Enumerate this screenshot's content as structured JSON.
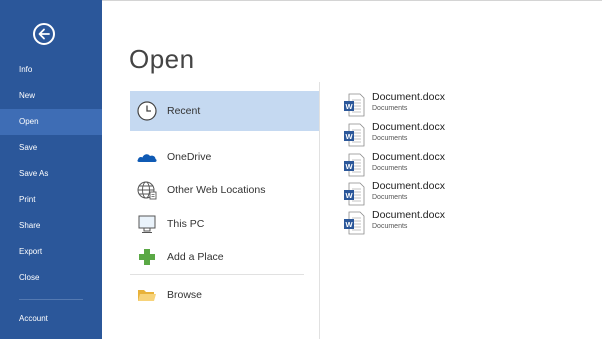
{
  "sidebar": {
    "items": [
      {
        "label": "Info"
      },
      {
        "label": "New"
      },
      {
        "label": "Open"
      },
      {
        "label": "Save"
      },
      {
        "label": "Save As"
      },
      {
        "label": "Print"
      },
      {
        "label": "Share"
      },
      {
        "label": "Export"
      },
      {
        "label": "Close"
      },
      {
        "label": "Account"
      }
    ],
    "active": "Open"
  },
  "page": {
    "title": "Open"
  },
  "places": [
    {
      "label": "Recent",
      "icon": "clock-icon",
      "selected": true
    },
    {
      "label": "OneDrive",
      "icon": "cloud-icon"
    },
    {
      "label": "Other Web Locations",
      "icon": "globe-icon"
    },
    {
      "label": "This PC",
      "icon": "computer-icon"
    },
    {
      "label": "Add a Place",
      "icon": "plus-icon"
    },
    {
      "label": "Browse",
      "icon": "folder-icon"
    }
  ],
  "recent_files": [
    {
      "name": "Document.docx",
      "path": "Documents",
      "icon": "word-doc-icon"
    },
    {
      "name": "Document.docx",
      "path": "Documents",
      "icon": "word-doc-icon"
    },
    {
      "name": "Document.docx",
      "path": "Documents",
      "icon": "word-doc-icon"
    },
    {
      "name": "Document.docx",
      "path": "Documents",
      "icon": "word-doc-icon"
    },
    {
      "name": "Document.docx",
      "path": "Documents",
      "icon": "word-doc-icon"
    }
  ],
  "colors": {
    "sidebar": "#2b579a",
    "sidebar_active": "#3e6db5",
    "selected_place": "#c5d9f1",
    "onedrive": "#0f5ab4",
    "add_place": "#5aa845",
    "folder": "#f2c14e"
  }
}
